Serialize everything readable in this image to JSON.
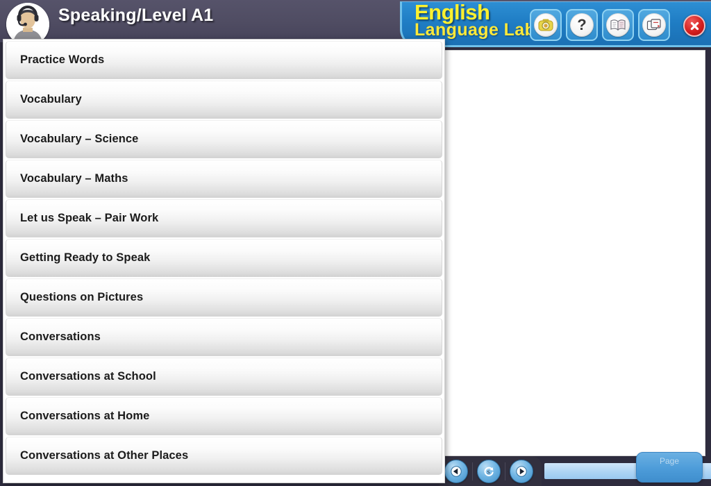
{
  "window": {
    "title": "Speaking/Level A1",
    "avatar_icon": "student-headset-avatar-icon"
  },
  "brand": {
    "line1": "English",
    "line2": "Language Lab"
  },
  "toolbar": {
    "buttons": [
      {
        "name": "media-recorder-button",
        "icon": "camera-icon",
        "label": ""
      },
      {
        "name": "help-button",
        "icon": "question-mark-icon",
        "label": "?"
      },
      {
        "name": "dictionary-button",
        "icon": "open-book-icon",
        "label": ""
      },
      {
        "name": "switch-window-button",
        "icon": "window-switch-icon",
        "label": ""
      }
    ],
    "close_label": "close-icon"
  },
  "menu": {
    "items": [
      {
        "label": "Practice Words"
      },
      {
        "label": "Vocabulary"
      },
      {
        "label": "Vocabulary – Science"
      },
      {
        "label": "Vocabulary – Maths"
      },
      {
        "label": "Let us Speak – Pair Work"
      },
      {
        "label": "Getting Ready to Speak"
      },
      {
        "label": "Questions on Pictures"
      },
      {
        "label": "Conversations"
      },
      {
        "label": "Conversations at School"
      },
      {
        "label": "Conversations at Home"
      },
      {
        "label": "Conversations at Other Places"
      }
    ]
  },
  "bottom": {
    "back_icon": "previous-triangle-icon",
    "replay_icon": "replay-loop-icon",
    "play_icon": "play-triangle-icon",
    "page_label": "Page"
  },
  "colors": {
    "titlebar": "#4f4c62",
    "brand_panel": "#1f7dc4",
    "brand_text": "#fff12e",
    "close": "#d51f1f",
    "accent_blue": "#4d9cd9",
    "app_background": "#2e2c3e"
  }
}
